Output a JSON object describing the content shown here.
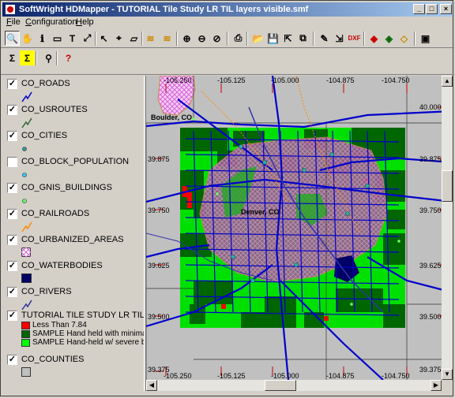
{
  "window": {
    "title": "SoftWright HDMapper - TUTORIAL Tile Study LR TIL layers visible.smf",
    "minimize_glyph": "_",
    "maximize_glyph": "□",
    "close_glyph": "×"
  },
  "menu": [
    {
      "label": "File",
      "accel": "F"
    },
    {
      "label": "Configuration",
      "accel": "C"
    },
    {
      "label": "Help",
      "accel": "H"
    }
  ],
  "toolbar_row1": [
    {
      "name": "zoom-tool-icon",
      "glyph": "🔍"
    },
    {
      "name": "pan-hand-icon",
      "glyph": "✋"
    },
    {
      "name": "info-icon",
      "glyph": "ℹ"
    },
    {
      "name": "label-tool-icon",
      "glyph": "▭"
    },
    {
      "name": "text-tool-icon",
      "glyph": "T"
    },
    {
      "name": "measure-tool-icon",
      "glyph": "⤢"
    },
    {
      "name": "select-arrow-icon",
      "glyph": "↖"
    },
    {
      "name": "select-point-icon",
      "glyph": "⌖"
    },
    {
      "name": "select-area-icon",
      "glyph": "▱"
    },
    {
      "name": "layers-icon",
      "glyph": "≋"
    },
    {
      "name": "layers-edit-icon",
      "glyph": "≋"
    },
    {
      "name": "zoom-in-icon",
      "glyph": "⊕"
    },
    {
      "name": "zoom-out-icon",
      "glyph": "⊖"
    },
    {
      "name": "zoom-cancel-icon",
      "glyph": "⊘"
    },
    {
      "name": "print-icon",
      "glyph": "⎙"
    },
    {
      "name": "open-folder-icon",
      "glyph": "📂"
    },
    {
      "name": "save-icon",
      "glyph": "💾"
    },
    {
      "name": "export-icon",
      "glyph": "⇱"
    },
    {
      "name": "copy-map-icon",
      "glyph": "⧉"
    },
    {
      "name": "edit-properties-icon",
      "glyph": "✎"
    },
    {
      "name": "import-icon",
      "glyph": "⇲"
    },
    {
      "name": "dxf-icon",
      "glyph": "DXF"
    },
    {
      "name": "layer-up-icon",
      "glyph": "◆"
    },
    {
      "name": "layer-stack-icon",
      "glyph": "◈"
    },
    {
      "name": "layer-down-icon",
      "glyph": "◇"
    },
    {
      "name": "map-window-icon",
      "glyph": "▣"
    }
  ],
  "toolbar_row2": [
    {
      "name": "sum-icon",
      "glyph": "Σ"
    },
    {
      "name": "sum-highlight-icon",
      "glyph": "Σ"
    },
    {
      "name": "wand-icon",
      "glyph": "⚲"
    },
    {
      "name": "help-icon",
      "glyph": "?"
    }
  ],
  "legend": {
    "layers": [
      {
        "name": "CO_ROADS",
        "checked": true,
        "symbol": "line",
        "color": "#0000cc"
      },
      {
        "name": "CO_USROUTES",
        "checked": true,
        "symbol": "line",
        "color": "#336633"
      },
      {
        "name": "CO_CITIES",
        "checked": true,
        "symbol": "dot",
        "color": "#339999"
      },
      {
        "name": "CO_BLOCK_POPULATION",
        "checked": false,
        "symbol": "dot",
        "color": "#33ccff"
      },
      {
        "name": "CO_GNIS_BUILDINGS",
        "checked": true,
        "symbol": "dot",
        "color": "#66ff66"
      },
      {
        "name": "CO_RAILROADS",
        "checked": true,
        "symbol": "line",
        "color": "#ff8800"
      },
      {
        "name": "CO_URBANIZED_AREAS",
        "checked": true,
        "symbol": "hatch",
        "color": "#cc66cc"
      },
      {
        "name": "CO_WATERBODIES",
        "checked": true,
        "symbol": "box",
        "color": "#000066"
      },
      {
        "name": "CO_RIVERS",
        "checked": true,
        "symbol": "line",
        "color": "#333399"
      },
      {
        "name": "TUTORIAL TILE STUDY LR TIL (DBU_",
        "checked": true,
        "symbol": "none",
        "color": "#000000"
      },
      {
        "name": "CO_COUNTIES",
        "checked": true,
        "symbol": "hollow",
        "color": "#666666"
      }
    ],
    "tile_legend": [
      {
        "label": "Less Than 7.84",
        "color": "#ff0000"
      },
      {
        "label": "SAMPLE Hand held with minimal bo",
        "color": "#006600"
      },
      {
        "label": "SAMPLE Hand-held w/ severe bo",
        "color": "#00ff00"
      }
    ]
  },
  "map": {
    "top_lon_labels": [
      "-105.250",
      "-105.125",
      "-105.000",
      "-104.875",
      "-104.750"
    ],
    "bottom_lon_labels": [
      "-105.250",
      "-105.125",
      "-105.000",
      "-104.875",
      "-104.750"
    ],
    "left_lat_labels": [
      "39.875",
      "39.750",
      "39.625",
      "39.500",
      "39.375"
    ],
    "right_lat_labels": [
      "40.000",
      "39.875",
      "39.750",
      "39.625",
      "39.500",
      "39.375"
    ],
    "city_labels": [
      "Boulder, CO",
      "Denver, CO"
    ]
  }
}
